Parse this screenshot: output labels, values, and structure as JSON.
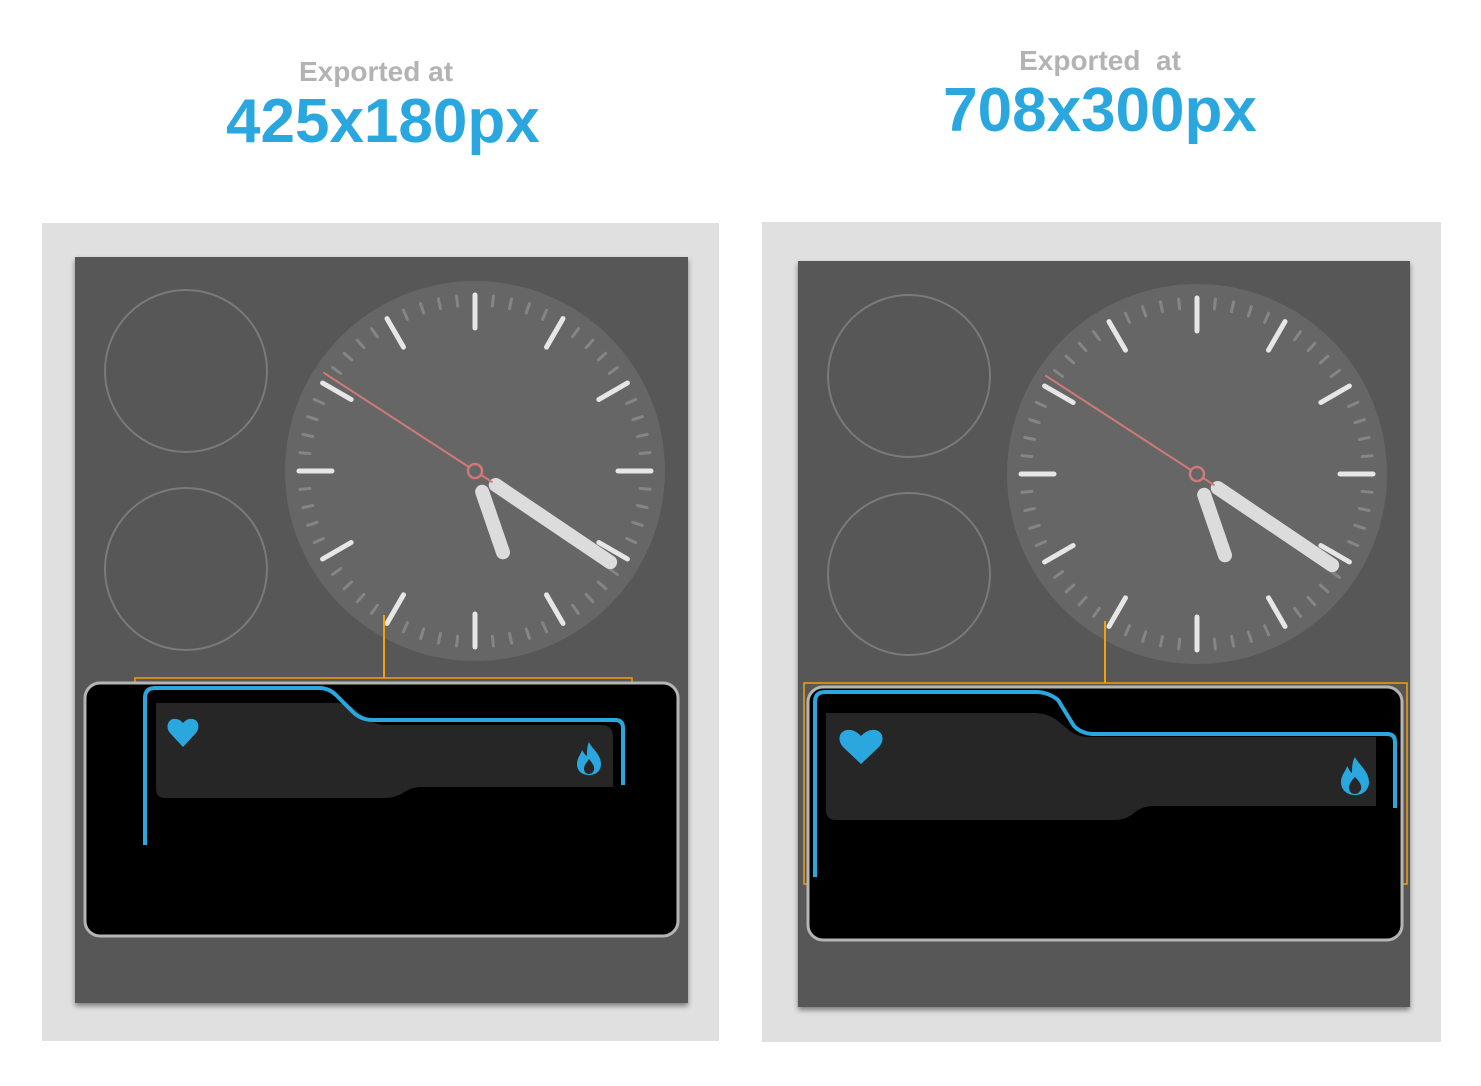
{
  "exports": [
    {
      "subtitle": "Exported at",
      "size": "425x180px"
    },
    {
      "subtitle": "Exported  at",
      "size": "708x300px"
    }
  ],
  "icons": {
    "left": "heart-icon",
    "right": "flame-icon"
  },
  "colors": {
    "accent": "#2aa7df",
    "screen": "#575757",
    "clock_face": "#666666",
    "selection": "#f0a10c",
    "second_hand": "#cf7a76",
    "panel": "#000000",
    "panel_inner": "#262626"
  }
}
